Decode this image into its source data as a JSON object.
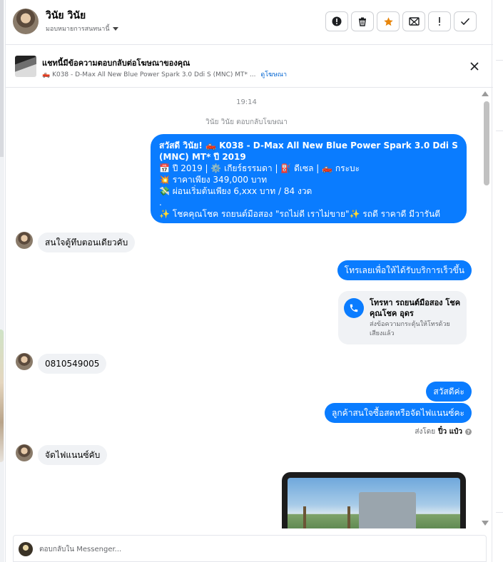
{
  "header": {
    "user_name": "วินัย วินัย",
    "assign_label": "มอบหมายการสนทนานี้"
  },
  "header_actions": [
    {
      "icon": "alert-circle-icon",
      "glyph": "!"
    },
    {
      "icon": "trash-icon"
    },
    {
      "icon": "star-icon",
      "color": "#e8860c"
    },
    {
      "icon": "mail-x-icon"
    },
    {
      "icon": "exclamation-icon",
      "glyph": "!"
    },
    {
      "icon": "check-icon"
    }
  ],
  "ad_banner": {
    "title": "แชทนี้มีข้อความตอบกลับต่อโฆษณาของคุณ",
    "ad_text": "🛻 K038 - D-Max All New Blue Power Spark 3.0 Ddi S (MNC) MT* ...",
    "link_label": "ดูโฆษณา"
  },
  "thread": {
    "time": "19:14",
    "reply_note": "วินัย วินัย ตอบกลับโฆษณา",
    "ad_message_lines": [
      "สวัสดี วินัย! 🛻 K038 - D-Max All New Blue Power Spark 3.0 Ddi S (MNC) MT* ปี 2019",
      "📅 ปี 2019 | ⚙️ เกียร์ธรรมดา | ⛽ ดีเซล | 🛻 กระบะ",
      "💥 ราคาเพียง 349,000 บาท",
      "💸 ผ่อนเริ่มต้นเพียง 6,xxx บาท / 84 งวด",
      ".",
      "✨ โชคคุณโชค รถยนต์มือสอง \"รถไม่ดี เราไม่ขาย\"✨ รถดี ราคาดี มีวารันตี"
    ],
    "msg_in_1": "สนใจตู้ทึบตอนเดียวคับ",
    "msg_out_1": "โทรเลยเพื่อให้ได้รับบริการเร็วขึ้น",
    "call_card": {
      "title": "โทรหา รถยนต์มือสอง โชคคุณโชค อุดร",
      "subtitle": "ส่งข้อความกระตุ้นให้โทรด้วยเสียงแล้ว"
    },
    "msg_in_2": "0810549005",
    "msg_out_2": "สวัสดีค่ะ",
    "msg_out_3": "ลูกค้าสนใจซื้อสดหรือจัดไฟแนนซ์คะ",
    "sent_by_label": "ส่งโดย",
    "sent_by_name": "ปิ๋ว แป๋ว",
    "msg_in_3": "จัดไฟแนนซ์คับ"
  },
  "composer": {
    "placeholder": "ตอบกลับใน Messenger..."
  },
  "colors": {
    "accent": "#0a7cff",
    "incoming_bubble": "#f0f2f5",
    "star": "#e8860c"
  }
}
